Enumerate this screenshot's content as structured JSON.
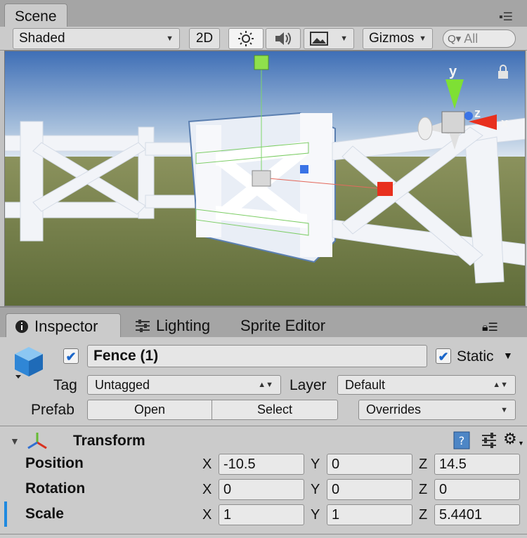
{
  "scene_tab": {
    "label": "Scene"
  },
  "toolbar": {
    "shading_mode": "Shaded",
    "mode_2d": "2D",
    "gizmos": "Gizmos",
    "search_placeholder": "All"
  },
  "orientation_gizmo": {
    "y": "y",
    "z": "z",
    "x": "x"
  },
  "inspector_tabs": [
    {
      "label": "Inspector"
    },
    {
      "label": "Lighting"
    },
    {
      "label": "Sprite Editor"
    }
  ],
  "object": {
    "name": "Fence (1)",
    "active": true,
    "static_label": "Static",
    "static": true,
    "tag_label": "Tag",
    "tag": "Untagged",
    "layer_label": "Layer",
    "layer": "Default",
    "prefab_label": "Prefab",
    "open_label": "Open",
    "select_label": "Select",
    "overrides_label": "Overrides"
  },
  "transform": {
    "title": "Transform",
    "rows": [
      {
        "label": "Position",
        "x": "-10.5",
        "y": "0",
        "z": "14.5"
      },
      {
        "label": "Rotation",
        "x": "0",
        "y": "0",
        "z": "0"
      },
      {
        "label": "Scale",
        "x": "1",
        "y": "1",
        "z": "5.4401"
      }
    ],
    "axis_x": "X",
    "axis_y": "Y",
    "axis_z": "Z"
  },
  "colors": {
    "accent_blue": "#1b66c9",
    "sky": "#4f7fc3",
    "ground": "#6d7a43",
    "fence": "#f2f4f8"
  }
}
